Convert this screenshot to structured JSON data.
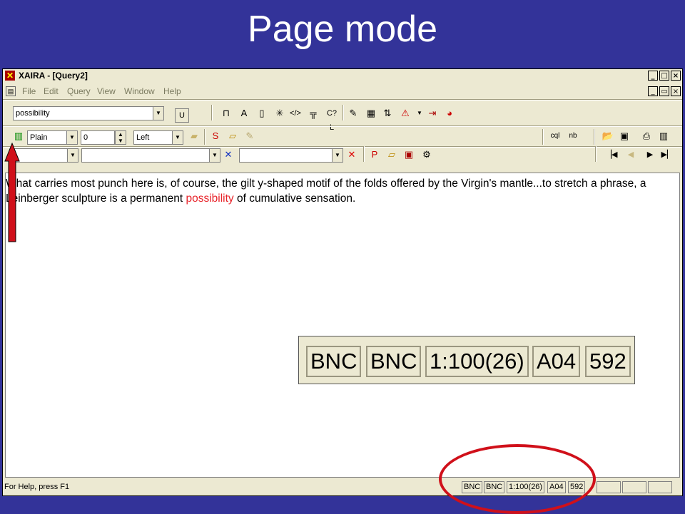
{
  "slide": {
    "title": "Page mode"
  },
  "window": {
    "title": "XAIRA - [Query2]",
    "app_icon": "xaira-logo-icon",
    "buttons": {
      "minimize": "_",
      "restore": "□",
      "close": "×"
    }
  },
  "menu": {
    "doc_icon": "document-icon",
    "items": [
      "File",
      "Edit",
      "Query",
      "View",
      "Window",
      "Help"
    ],
    "buttons": {
      "minimize": "_",
      "restore": "▭",
      "close": "×"
    }
  },
  "toolbar1": {
    "query_value": "possibility",
    "u_label": "U"
  },
  "toolbar2": {
    "style_value": "Plain",
    "size_value": "0",
    "align_value": "Left"
  },
  "toolbar3": {
    "field1_value": "",
    "field2_value": "",
    "field3_value": ""
  },
  "document": {
    "text_before": "What carries most punch here is, of course, the gilt y-shaped motif of the folds offered by the Virgin's mantle...to stretch a phrase, a Leinberger sculpture is a permanent ",
    "highlight": "possibility",
    "text_after": " of cumulative sensation.",
    "highlight_color": "#e8232a"
  },
  "statusbar": {
    "help_text": "For Help, press F1",
    "panes": [
      "BNC",
      "BNC",
      "1:100(26)",
      "A04",
      "592"
    ]
  },
  "zoom_panel": {
    "panes": [
      "BNC",
      "BNC",
      "1:100(26)",
      "A04",
      "592"
    ]
  },
  "colors": {
    "slide_background": "#333399",
    "window_face": "#ece9d2",
    "annotation_red": "#d0101a"
  }
}
